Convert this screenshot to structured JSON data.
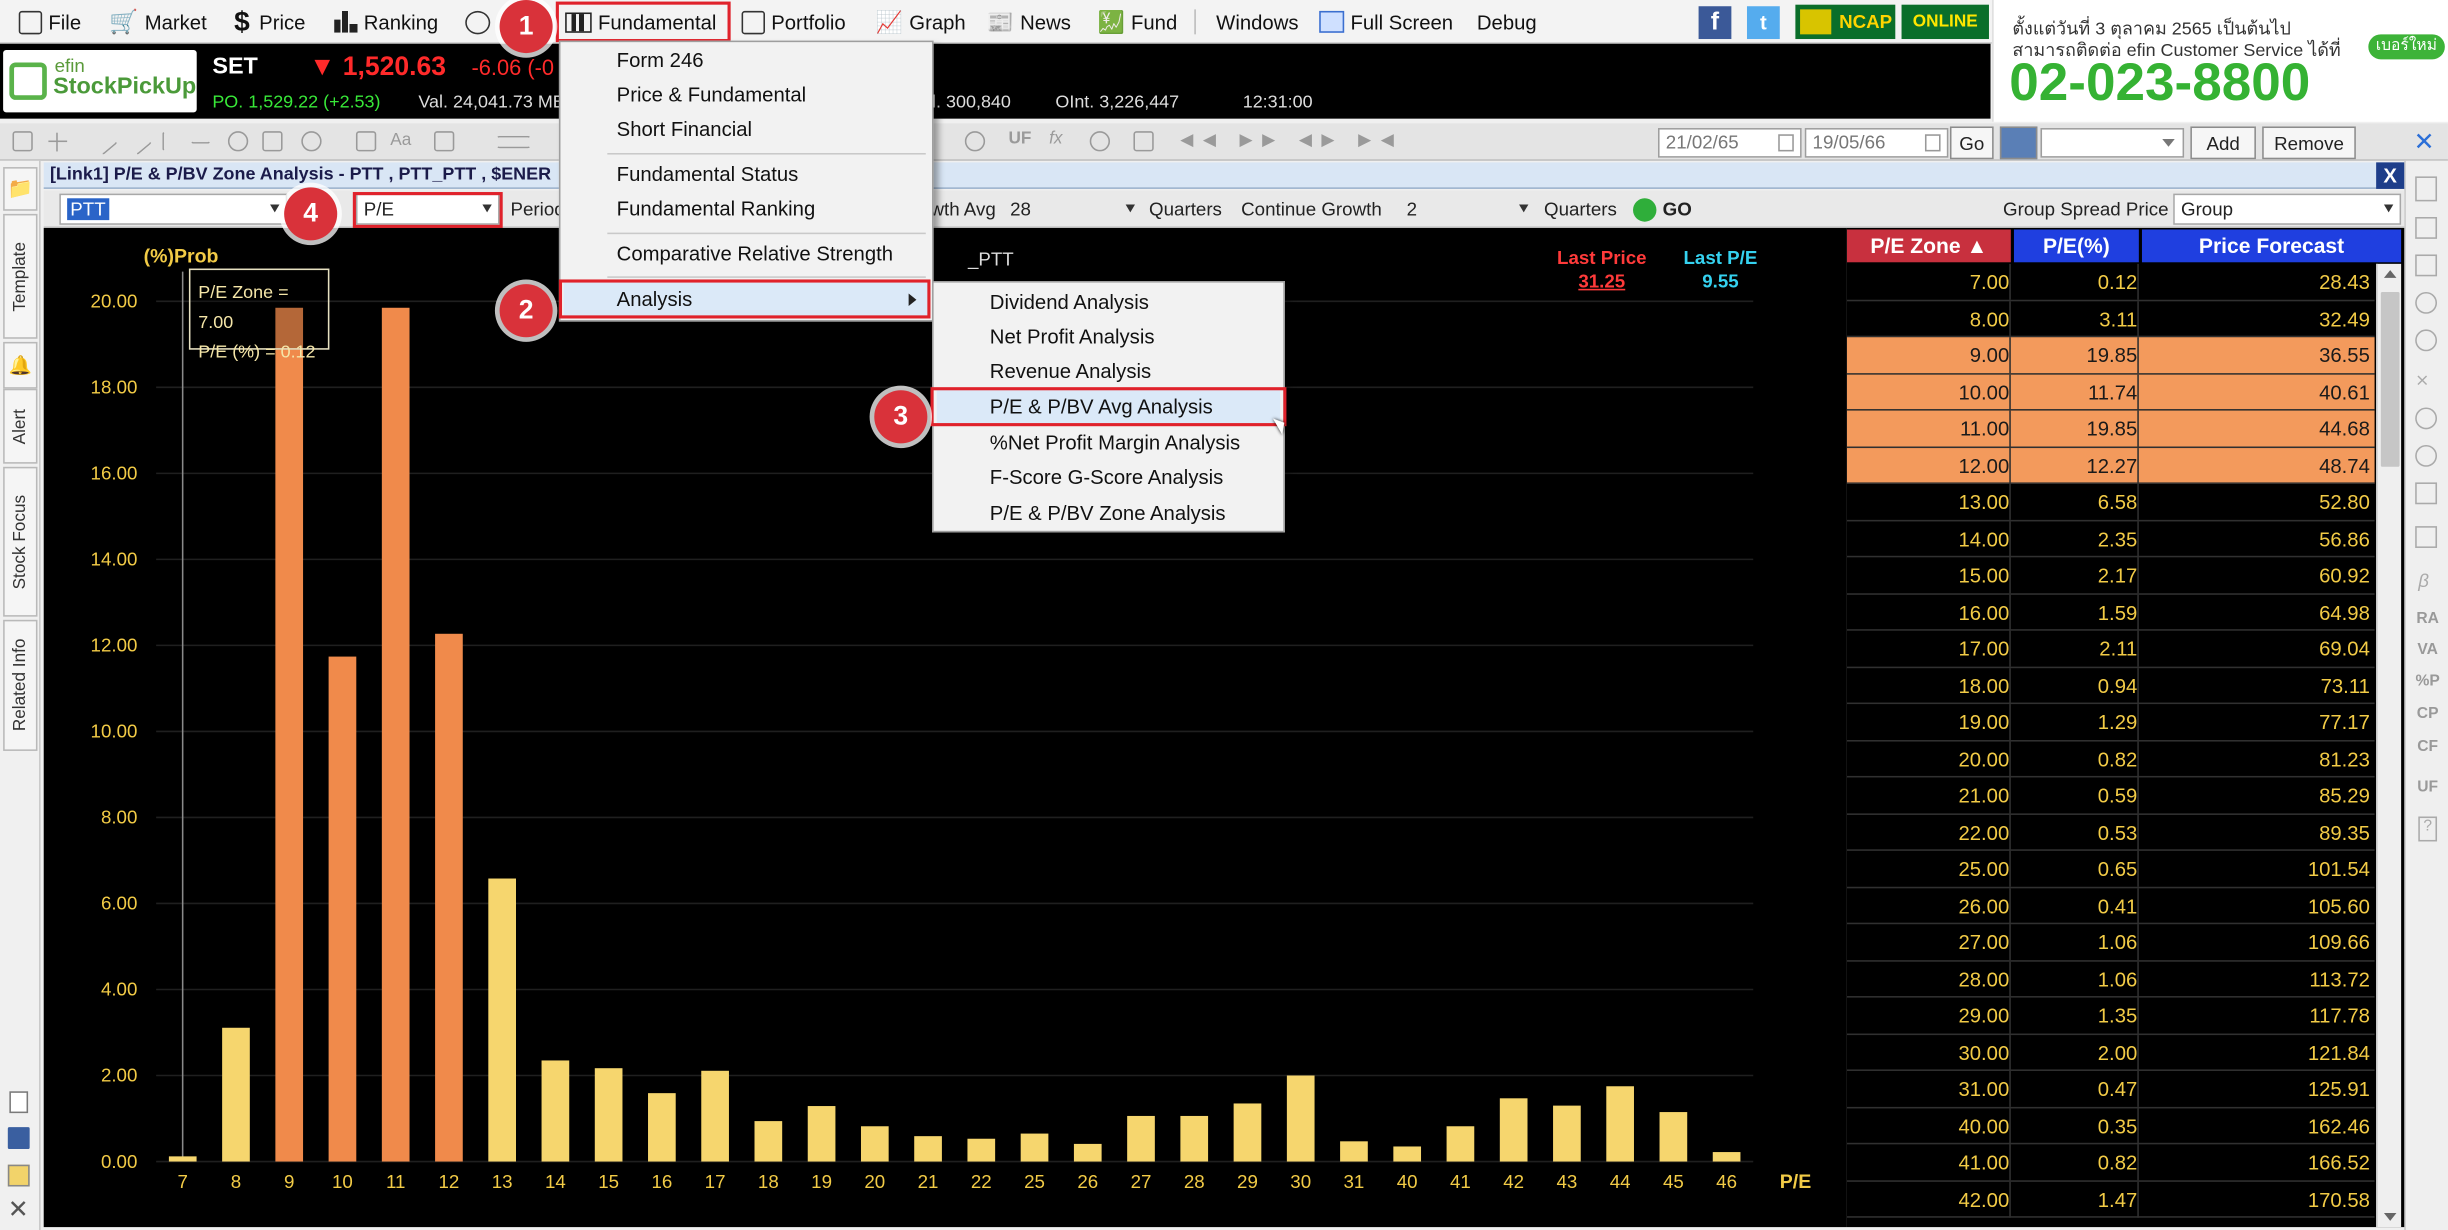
{
  "menubar": {
    "items": [
      "File",
      "Market",
      "Price",
      "Ranking",
      "Fundamental",
      "Portfolio",
      "Graph",
      "News",
      "Fund",
      "Windows",
      "Full Screen",
      "Debug"
    ],
    "ncap": "NCAP",
    "online": "ONLINE"
  },
  "logo": {
    "line1": "efin",
    "line2": "StockPickUp"
  },
  "quote": {
    "index": "SET",
    "price": "▼ 1,520.63",
    "change": "-6.06 (-0",
    "po": "PO. 1,529.22 (+2.53)",
    "val": "Val. 24,041.73 MB",
    "vol": "l. 300,840",
    "oint": "OInt. 3,226,447",
    "time": "12:31:00"
  },
  "banner": {
    "line1": "ตั้งแต่วันที่ 3 ตุลาคม 2565 เป็นต้นไป",
    "line2": "สามารถติดต่อ efin Customer Service ได้ที่",
    "phone": "02-023-8800",
    "tag": "เบอร์ใหม่"
  },
  "toolbar": {
    "uf": "UF",
    "date_from": "21/02/65",
    "date_to": "19/05/66",
    "go": "Go",
    "add": "Add",
    "remove": "Remove"
  },
  "window": {
    "title": "[Link1] P/E & P/BV Zone Analysis - PTT , PTT_PTT , $ENER",
    "close": "X"
  },
  "params": {
    "symbol": "PTT",
    "metric": "P/E",
    "period_label": "Period",
    "growth_avg_label": "wth Avg",
    "growth_avg_value": "28",
    "quarters1": "Quarters",
    "continue_growth_label": "Continue Growth",
    "continue_growth_value": "2",
    "quarters2": "Quarters",
    "go": "GO",
    "group_spread_label": "Group Spread Price",
    "group_value": "Group"
  },
  "sidebar": {
    "tabs": [
      "Template",
      "Alert",
      "Stock Focus",
      "Related Info"
    ],
    "right_labels": [
      "RA",
      "VA",
      "%P",
      "CP",
      "CF",
      "UF"
    ]
  },
  "menus": {
    "fundamental": [
      "Form 246",
      "Price & Fundamental",
      "Short Financial",
      "Fundamental Status",
      "Fundamental Ranking",
      "Comparative Relative Strength",
      "Analysis"
    ],
    "analysis": [
      "Dividend Analysis",
      "Net Profit Analysis",
      "Revenue Analysis",
      "P/E & P/BV Avg Analysis",
      "%Net Profit Margin Analysis",
      "F-Score G-Score Analysis",
      "P/E & P/BV Zone Analysis"
    ]
  },
  "badges": [
    "1",
    "2",
    "3",
    "4"
  ],
  "chart_data": {
    "type": "bar",
    "ylabel": "(%)Prob",
    "xlabel": "P/E",
    "subtitle_fragment": "_PTT",
    "categories": [
      "7",
      "8",
      "9",
      "10",
      "11",
      "12",
      "13",
      "14",
      "15",
      "16",
      "17",
      "18",
      "19",
      "20",
      "21",
      "22",
      "25",
      "26",
      "27",
      "28",
      "29",
      "30",
      "31",
      "40",
      "41",
      "42",
      "43",
      "44",
      "45",
      "46"
    ],
    "values": [
      0.12,
      3.11,
      19.85,
      11.74,
      19.85,
      12.27,
      6.58,
      2.35,
      2.17,
      1.59,
      2.11,
      0.94,
      1.29,
      0.82,
      0.59,
      0.53,
      0.65,
      0.41,
      1.06,
      1.06,
      1.35,
      2.0,
      0.47,
      0.35,
      0.82,
      1.47,
      1.3,
      1.75,
      1.15,
      0.22
    ],
    "highlight_categories": [
      "9",
      "10",
      "11",
      "12"
    ],
    "ylim": [
      0,
      20
    ],
    "yticks": [
      "0.00",
      "2.00",
      "4.00",
      "6.00",
      "8.00",
      "10.00",
      "12.00",
      "14.00",
      "16.00",
      "18.00",
      "20.00"
    ],
    "colors": {
      "normal": "#f6d66e",
      "highlight": "#f08a4b",
      "background": "#000000"
    },
    "tooltip": {
      "zone": "P/E Zone = 7.00",
      "pct": "P/E (%) = 0.12"
    },
    "last_price_label": "Last Price",
    "last_price_value": "31.25",
    "last_pe_label": "Last P/E",
    "last_pe_value": "9.55"
  },
  "table": {
    "headers": [
      "P/E Zone ▲",
      "P/E(%)",
      "Price Forecast"
    ],
    "rows": [
      [
        "7.00",
        "0.12",
        "28.43"
      ],
      [
        "8.00",
        "3.11",
        "32.49"
      ],
      [
        "9.00",
        "19.85",
        "36.55"
      ],
      [
        "10.00",
        "11.74",
        "40.61"
      ],
      [
        "11.00",
        "19.85",
        "44.68"
      ],
      [
        "12.00",
        "12.27",
        "48.74"
      ],
      [
        "13.00",
        "6.58",
        "52.80"
      ],
      [
        "14.00",
        "2.35",
        "56.86"
      ],
      [
        "15.00",
        "2.17",
        "60.92"
      ],
      [
        "16.00",
        "1.59",
        "64.98"
      ],
      [
        "17.00",
        "2.11",
        "69.04"
      ],
      [
        "18.00",
        "0.94",
        "73.11"
      ],
      [
        "19.00",
        "1.29",
        "77.17"
      ],
      [
        "20.00",
        "0.82",
        "81.23"
      ],
      [
        "21.00",
        "0.59",
        "85.29"
      ],
      [
        "22.00",
        "0.53",
        "89.35"
      ],
      [
        "25.00",
        "0.65",
        "101.54"
      ],
      [
        "26.00",
        "0.41",
        "105.60"
      ],
      [
        "27.00",
        "1.06",
        "109.66"
      ],
      [
        "28.00",
        "1.06",
        "113.72"
      ],
      [
        "29.00",
        "1.35",
        "117.78"
      ],
      [
        "30.00",
        "2.00",
        "121.84"
      ],
      [
        "31.00",
        "0.47",
        "125.91"
      ],
      [
        "40.00",
        "0.35",
        "162.46"
      ],
      [
        "41.00",
        "0.82",
        "166.52"
      ],
      [
        "42.00",
        "1.47",
        "170.58"
      ]
    ],
    "highlight_rows": [
      2,
      3,
      4,
      5
    ],
    "header_colors": {
      "zone": "#c8303e",
      "pct": "#1f3fe0",
      "forecast": "#1f3fe0"
    }
  }
}
